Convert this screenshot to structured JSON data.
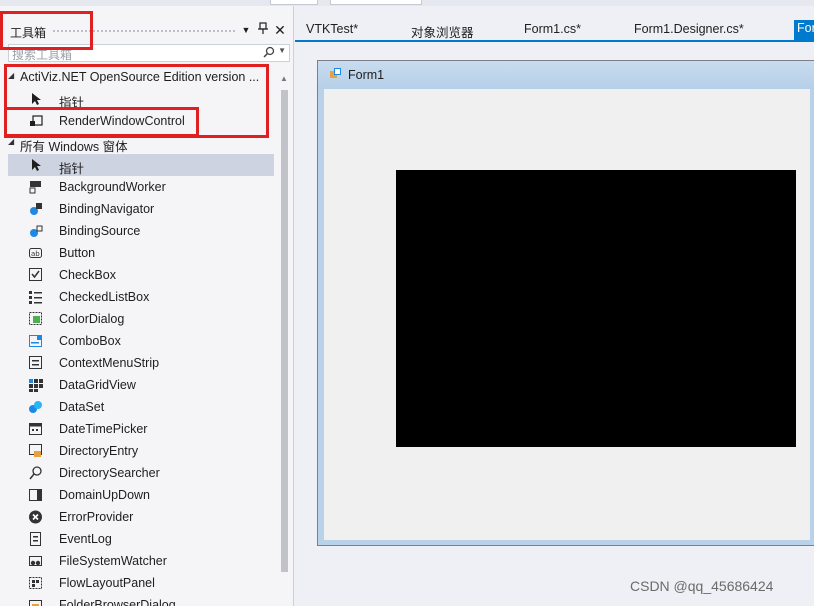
{
  "toolbox": {
    "title": "工具箱",
    "search_placeholder": "搜索工具箱",
    "groups": [
      {
        "name": "ActiViz.NET OpenSource Edition version ...",
        "items": [
          "指针",
          "RenderWindowControl"
        ]
      },
      {
        "name": "所有 Windows 窗体",
        "items": [
          "指针",
          "BackgroundWorker",
          "BindingNavigator",
          "BindingSource",
          "Button",
          "CheckBox",
          "CheckedListBox",
          "ColorDialog",
          "ComboBox",
          "ContextMenuStrip",
          "DataGridView",
          "DataSet",
          "DateTimePicker",
          "DirectoryEntry",
          "DirectorySearcher",
          "DomainUpDown",
          "ErrorProvider",
          "EventLog",
          "FileSystemWatcher",
          "FlowLayoutPanel",
          "FolderBrowserDialog"
        ]
      }
    ],
    "selected_item": "指针"
  },
  "tabs": [
    "VTKTest*",
    "对象浏览器",
    "Form1.cs*",
    "Form1.Designer.cs*",
    "For"
  ],
  "designer": {
    "form_title": "Form1"
  },
  "watermark": "CSDN @qq_45686424",
  "colors": {
    "highlight": "#e02020",
    "accent": "#007acc",
    "selection": "#cdd3e0"
  }
}
